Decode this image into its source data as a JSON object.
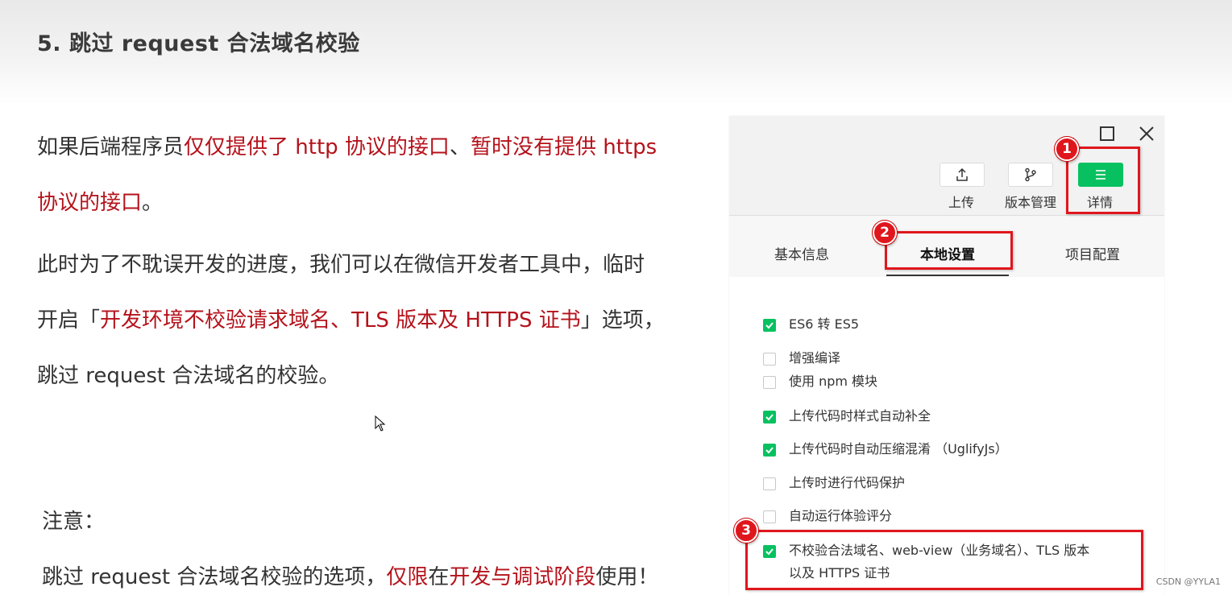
{
  "slide": {
    "title": "5. 跳过 request 合法域名校验",
    "p1_line1_a": "如果后端程序员",
    "p1_line1_b": "仅仅提供了 http 协议的接口",
    "p1_line1_c": "、",
    "p1_line1_d": "暂时没有提供 https",
    "p1_line2_a": "协议的接口",
    "p1_line2_b": "。",
    "p2_line1": "此时为了不耽误开发的进度，我们可以在微信开发者工具中，临时",
    "p2_line2_a": "开启「",
    "p2_line2_b": "开发环境不校验请求域名、TLS 版本及 HTTPS 证书",
    "p2_line2_c": "」选项，",
    "p2_line3": "跳过 request 合法域名的校验。",
    "note_label": "注意：",
    "note_a": "跳过 request 合法域名校验的选项，",
    "note_b": "仅限",
    "note_c": "在",
    "note_d": "开发与调试阶段",
    "note_e": "使用！"
  },
  "panel": {
    "toolbar": {
      "upload_label": "上传",
      "version_label": "版本管理",
      "details_label": "详情"
    },
    "tabs": {
      "basic": "基本信息",
      "local": "本地设置",
      "project": "项目配置"
    },
    "options": [
      {
        "label": "ES6 转 ES5",
        "checked": true
      },
      {
        "label": "增强编译",
        "checked": false
      },
      {
        "label": "使用 npm 模块",
        "checked": false
      },
      {
        "label": "上传代码时样式自动补全",
        "checked": true
      },
      {
        "label": "上传代码时自动压缩混淆 （UglifyJs）",
        "checked": true
      },
      {
        "label": "上传时进行代码保护",
        "checked": false
      },
      {
        "label": "自动运行体验评分",
        "checked": false
      },
      {
        "label": "不校验合法域名、web-view（业务域名）、TLS 版本以及 HTTPS 证书",
        "checked": true
      }
    ]
  },
  "badges": {
    "one": "1",
    "two": "2",
    "three": "3"
  },
  "watermark": "CSDN @YYLA1",
  "colors": {
    "accent_red": "#b5121b",
    "highlight_red": "#e0161d",
    "wechat_green": "#07c160"
  }
}
